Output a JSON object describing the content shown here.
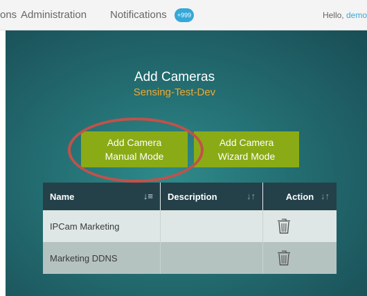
{
  "topnav": {
    "partial_item": "ons",
    "administration": "Administration",
    "notifications": "Notifications",
    "badge_count": "+999",
    "hello_prefix": "Hello, ",
    "hello_user": "demo"
  },
  "page": {
    "title": "Add Cameras",
    "subtitle": "Sensing-Test-Dev"
  },
  "buttons": {
    "manual_line1": "Add Camera",
    "manual_line2": "Manual Mode",
    "wizard_line1": "Add Camera",
    "wizard_line2": "Wizard Mode"
  },
  "table": {
    "headers": {
      "name": "Name",
      "description": "Description",
      "action": "Action"
    },
    "rows": [
      {
        "name": "IPCam Marketing",
        "description": ""
      },
      {
        "name": "Marketing DDNS",
        "description": ""
      }
    ]
  },
  "icons": {
    "sort_asc": "sort-ascending-icon",
    "sort": "sort-icon",
    "trash": "trash-icon"
  },
  "colors": {
    "accent_green": "#8aab16",
    "subtitle_orange": "#f0a830",
    "badge_blue": "#35a8d9",
    "highlight_red": "#c0524a",
    "table_header": "#24414a"
  }
}
